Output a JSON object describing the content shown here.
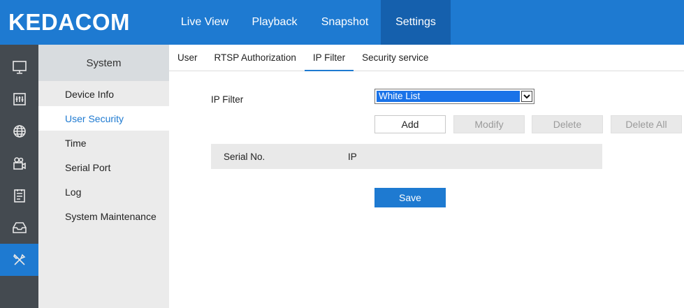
{
  "brand": {
    "logo_text": "KEDACOM"
  },
  "top_nav": [
    {
      "label": "Live View",
      "active": false
    },
    {
      "label": "Playback",
      "active": false
    },
    {
      "label": "Snapshot",
      "active": false
    },
    {
      "label": "Settings",
      "active": true
    }
  ],
  "rail": {
    "icons": [
      "monitor-icon",
      "equalizer-icon",
      "globe-icon",
      "camera-icon",
      "schedule-icon",
      "storage-icon",
      "tools-icon"
    ],
    "active_icon": "tools-icon"
  },
  "sidebar": {
    "title": "System",
    "items": [
      {
        "label": "Device Info",
        "active": false
      },
      {
        "label": "User Security",
        "active": true
      },
      {
        "label": "Time",
        "active": false
      },
      {
        "label": "Serial Port",
        "active": false
      },
      {
        "label": "Log",
        "active": false
      },
      {
        "label": "System Maintenance",
        "active": false
      }
    ]
  },
  "tabs": [
    {
      "label": "User",
      "active": false
    },
    {
      "label": "RTSP Authorization",
      "active": false
    },
    {
      "label": "IP Filter",
      "active": true
    },
    {
      "label": "Security service",
      "active": false
    }
  ],
  "ip_filter": {
    "label": "IP Filter",
    "selected_option": "White List",
    "buttons": {
      "add": "Add",
      "modify": "Modify",
      "delete": "Delete",
      "delete_all": "Delete All"
    },
    "table_headers": {
      "serial_no": "Serial No.",
      "ip": "IP"
    },
    "rows": [],
    "save_label": "Save"
  },
  "colors": {
    "accent": "#1e7ad1",
    "accent_dark": "#1560ad",
    "rail_bg": "#444a50",
    "sidebar_bg": "#ebebeb"
  }
}
